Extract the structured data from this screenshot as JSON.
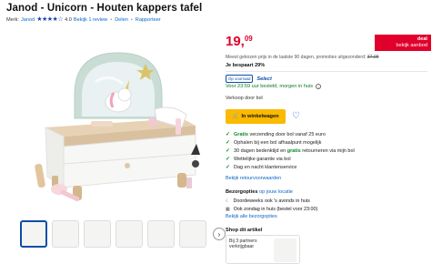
{
  "product": {
    "title": "Janod - Unicorn - Houten kappers tafel",
    "brand_label": "Merk:",
    "brand": "Janod",
    "rating": 4.0,
    "rating_text": "4.0",
    "review_link": "Bekijk 1 review",
    "share": "Delen",
    "report": "Rapporteer"
  },
  "price": {
    "main": "19,",
    "cents": "09",
    "deal_label": "deal",
    "deal_link": "bekijk aanbod",
    "ref_text": "Meest gekozen prijs in de laatste 90 dagen, promoties uitgezonderd:",
    "ref_price": "37,09",
    "savings": "Je bespaart 29%"
  },
  "stock": {
    "badge": "Op voorraad",
    "select_label": "Select",
    "delivery": "Voor 23:59 uur besteld, morgen in huis",
    "seller": "Verkoop door bol"
  },
  "cart": {
    "button_label": "In winkelwagen"
  },
  "usps": [
    {
      "strong": "Gratis",
      "rest": " verzending door bol vanaf 25 euro"
    },
    {
      "strong": "",
      "rest": "Ophalen bij een bol afhaalpunt mogelijk"
    },
    {
      "strong": "",
      "rest": "30 dagen bedenktijd en ",
      "strong2": "gratis",
      "rest2": " retourneren via mijn bol"
    },
    {
      "strong": "",
      "rest": "Wettelijke garantie via bol"
    },
    {
      "strong": "",
      "rest": "Dag en nacht klantenservice"
    }
  ],
  "returns_link": "Bekijk retourvoorwaarden",
  "delivery_options": {
    "heading": "Bezorgopties",
    "location_link": "op jouw locatie",
    "items": [
      "Doordeweeks ook 's avonds in huis",
      "Ook zondag in huis (bestel voor 23:00)"
    ],
    "all_link": "Bekijk alle bezorgopties"
  },
  "shop": {
    "heading": "Shop dit artikel",
    "partners": "Bij 3 partners verkrijgbaar"
  },
  "colors": {
    "accent_blue": "#0a4ea8",
    "price_red": "#e0002b",
    "cart_yellow": "#fbb900",
    "green": "#0a8a2b"
  }
}
